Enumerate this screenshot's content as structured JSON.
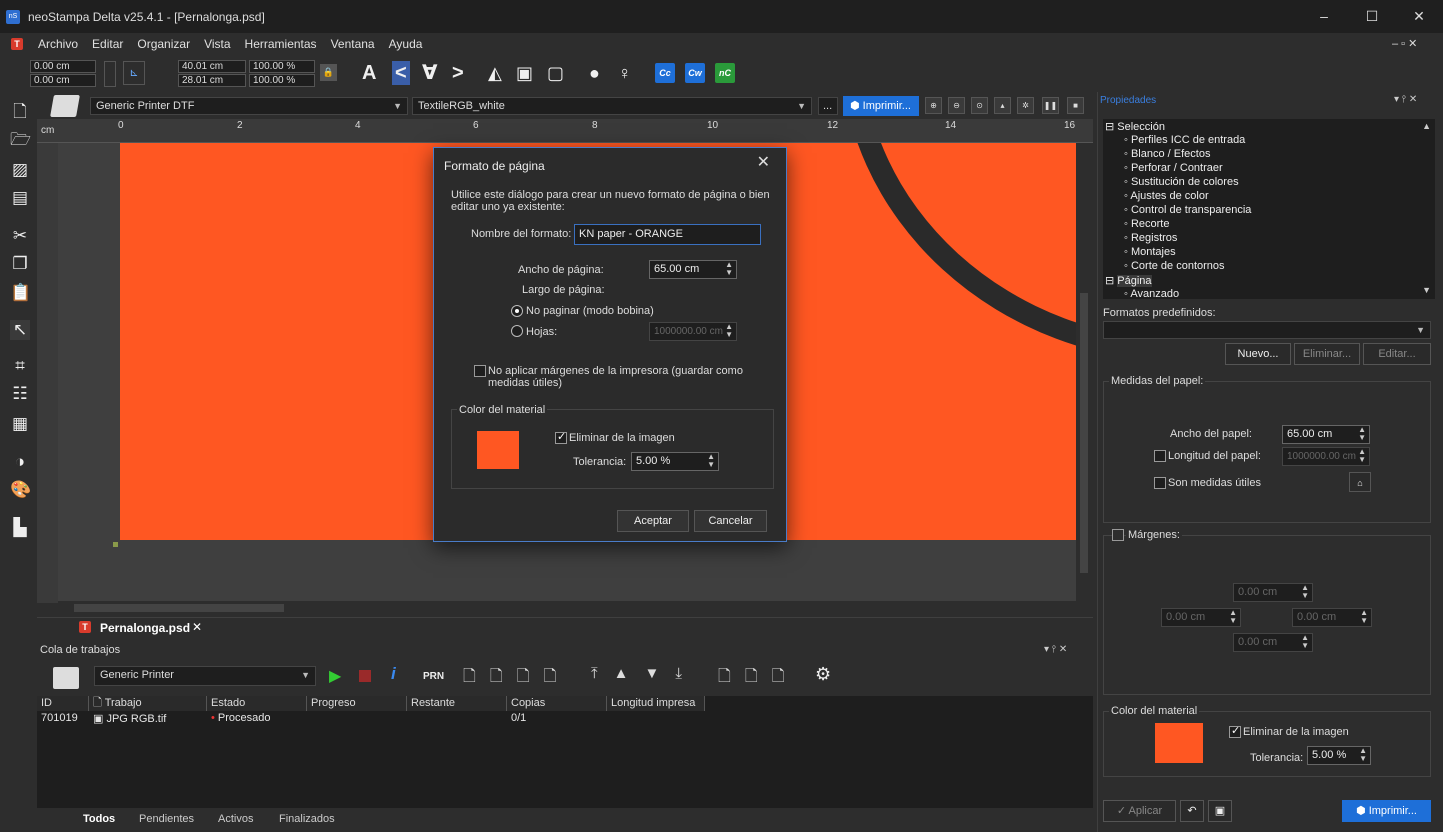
{
  "window": {
    "title": "neoStampa Delta  v25.4.1 - [Pernalonga.psd]",
    "app_icon": "nS"
  },
  "menu": [
    "Archivo",
    "Editar",
    "Organizar",
    "Vista",
    "Herramientas",
    "Ventana",
    "Ayuda"
  ],
  "toolbar": {
    "x": "0.00 cm",
    "y": "0.00 cm",
    "w": "40.01 cm",
    "h": "28.01 cm",
    "sx": "100.00 %",
    "sy": "100.00 %",
    "badges": [
      "Cc",
      "Cw",
      "nC"
    ]
  },
  "printer": {
    "name": "Generic Printer DTF",
    "profile": "TextileRGB_white",
    "more": "...",
    "print_btn": "Imprimir..."
  },
  "ruler": {
    "unit": "cm",
    "ticks": [
      "0",
      "2",
      "4",
      "6",
      "8",
      "10",
      "12",
      "14",
      "16"
    ]
  },
  "doc_tab": {
    "name": "Pernalonga.psd",
    "close": "✕"
  },
  "queue": {
    "title": "Cola de trabajos",
    "printer": "Generic Printer",
    "prn": "PRN",
    "columns": [
      "ID",
      "Trabajo",
      "Estado",
      "Progreso",
      "Restante",
      "Copias",
      "Longitud impresa"
    ],
    "rows": [
      {
        "id": "701019",
        "job": "JPG RGB.tif",
        "status": "Procesado",
        "progress": "",
        "remaining": "",
        "copies": "0/1",
        "length": ""
      }
    ],
    "tabs": [
      "Todos",
      "Pendientes",
      "Activos",
      "Finalizados"
    ]
  },
  "props": {
    "title": "Propiedades",
    "tree": [
      "Selección",
      "Perfiles ICC de entrada",
      "Blanco / Efectos",
      "Perforar / Contraer",
      "Sustitución de colores",
      "Ajustes de color",
      "Control de transparencia",
      "Recorte",
      "Registros",
      "Montajes",
      "Corte de contornos",
      "Página",
      "Avanzado"
    ],
    "formatos_label": "Formatos predefinidos:",
    "btn_nuevo": "Nuevo...",
    "btn_eliminar": "Eliminar...",
    "btn_editar": "Editar...",
    "medidas_label": "Medidas del papel:",
    "ancho_label": "Ancho del papel:",
    "ancho_val": "65.00 cm",
    "longitud_label": "Longitud del papel:",
    "longitud_val": "1000000.00 cm",
    "utiles_label": "Son medidas útiles",
    "margenes_label": "Márgenes:",
    "margin_val": "0.00 cm",
    "color_label": "Color del material",
    "eliminar_label": "Eliminar de la imagen",
    "tol_label": "Tolerancia:",
    "tol_val": "5.00 %",
    "aplicar": "Aplicar",
    "imprimir": "Imprimir..."
  },
  "dialog": {
    "title": "Formato de página",
    "desc": "Utilice este diálogo para crear un nuevo formato de página o bien editar uno ya existente:",
    "nombre_label": "Nombre del formato:",
    "nombre_val": "KN paper - ORANGE",
    "ancho_label": "Ancho de página:",
    "ancho_val": "65.00 cm",
    "largo_label": "Largo de página:",
    "radio1": "No paginar (modo bobina)",
    "radio2": "Hojas:",
    "hojas_val": "1000000.00 cm",
    "margins_check": "No aplicar márgenes de la impresora (guardar como medidas útiles)",
    "color_label": "Color del material",
    "eliminar_label": "Eliminar de la imagen",
    "tol_label": "Tolerancia:",
    "tol_val": "5.00 %",
    "ok": "Aceptar",
    "cancel": "Cancelar"
  },
  "colors": {
    "material": "#ff5722",
    "accent": "#1e6fd8"
  }
}
